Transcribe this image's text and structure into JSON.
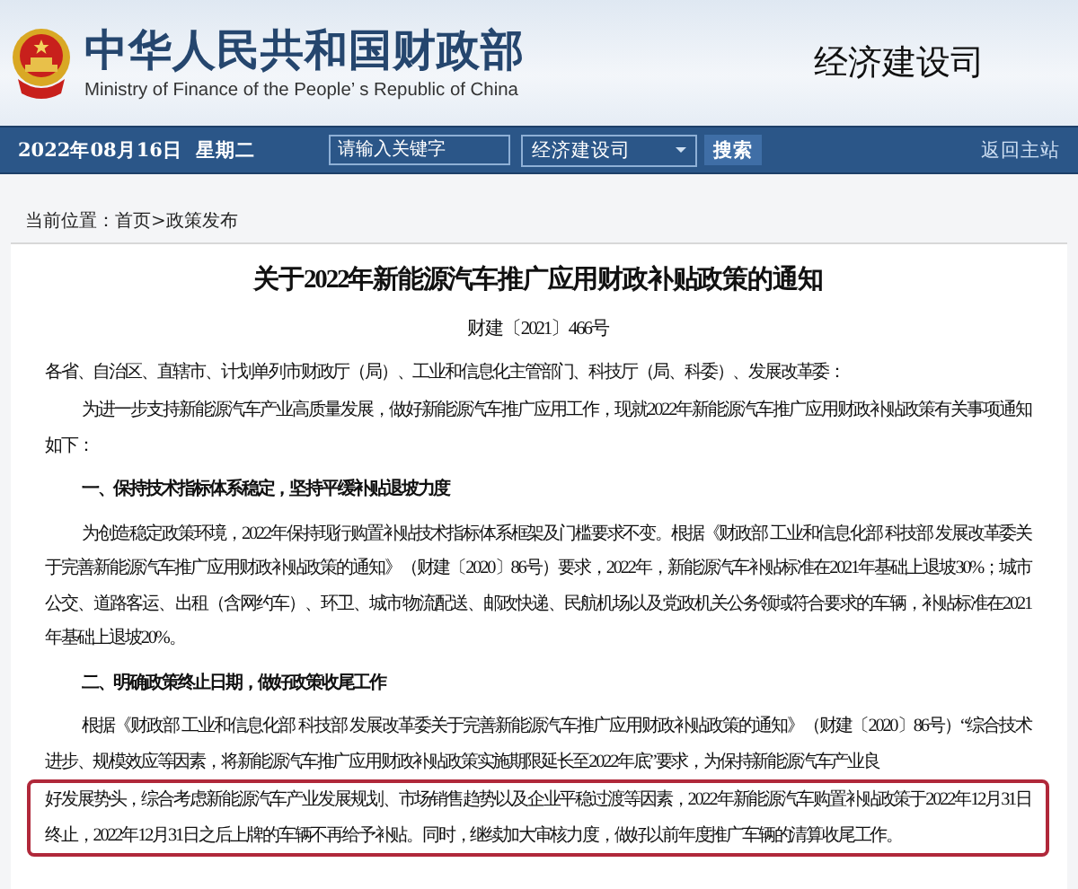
{
  "header": {
    "title": "中华人民共和国财政部",
    "subtitle": "Ministry of Finance of the People’ s Republic of China",
    "department": "经济建设司"
  },
  "nav": {
    "date": "2022年08月16日  星期二",
    "search": {
      "placeholder": "请输入关键字"
    },
    "scope": "经济建设司",
    "search_button": "搜索",
    "home_link": "返回主站"
  },
  "breadcrumb": "当前位置：首页>政策发布",
  "article": {
    "title": "关于2022年新能源汽车推广应用财政补贴政策的通知",
    "doc_number": "财建〔2021〕466号",
    "addressee": "各省、自治区、直辖市、计划单列市财政厅（局）、工业和信息化主管部门、科技厅（局、科委）、发展改革委：",
    "blocks": [
      {
        "kind": "paragraph",
        "text": "为进一步支持新能源汽车产业高质量发展，做好新能源汽车推广应用工作，现就2022年新能源汽车推广应用财政补贴政策有关事项通知如下："
      },
      {
        "kind": "heading",
        "text": "一、保持技术指标体系稳定，坚持平缓补贴退坡力度"
      },
      {
        "kind": "paragraph",
        "text": "为创造稳定政策环境，2022年保持现行购置补贴技术指标体系框架及门槛要求不变。根据《财政部 工业和信息化部 科技部 发展改革委关于完善新能源汽车推广应用财政补贴政策的通知》（财建〔2020〕86号）要求，2022年，新能源汽车补贴标准在2021年基础上退坡30%；城市公交、道路客运、出租（含网约车）、环卫、城市物流配送、邮政快递、民航机场以及党政机关公务领域符合要求的车辆，补贴标准在2021年基础上退坡20%。"
      },
      {
        "kind": "heading",
        "text": "二、明确政策终止日期，做好政策收尾工作"
      },
      {
        "kind": "paragraph",
        "text": "根据《财政部 工业和信息化部 科技部 发展改革委关于完善新能源汽车推广应用财政补贴政策的通知》（财建〔2020〕86号）“综合技术进步、规模效应等因素，将新能源汽车推广应用财政补贴政策实施期限延长至2022年底”要求，为保持新能源汽车产业良",
        "highlight": "好发展势头，综合考虑新能源汽车产业发展规划、市场销售趋势以及企业平稳过渡等因素，2022年新能源汽车购置补贴政策于2022年12月31日终止，2022年12月31日之后上牌的车辆不再给予补贴。同时，继续加大审核力度，做好以前年度推广车辆的清算收尾工作。"
      }
    ]
  }
}
